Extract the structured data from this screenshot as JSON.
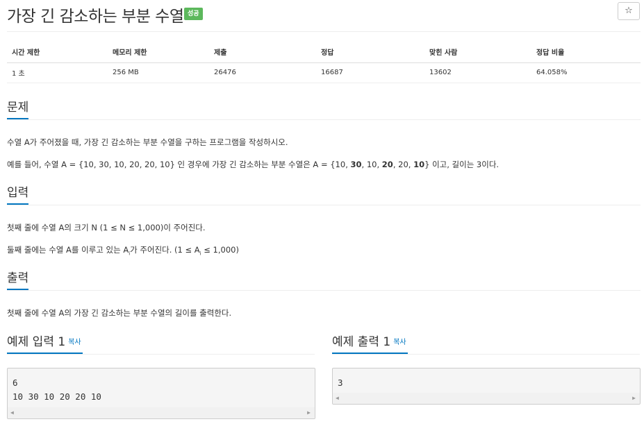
{
  "header": {
    "title": "가장 긴 감소하는 부분 수열",
    "badge": "성공",
    "star": "☆"
  },
  "info_table": {
    "headers": [
      "시간 제한",
      "메모리 제한",
      "제출",
      "정답",
      "맞힌 사람",
      "정답 비율"
    ],
    "row": [
      "1 초",
      "256 MB",
      "26476",
      "16687",
      "13602",
      "64.058%"
    ]
  },
  "problem": {
    "heading": "문제",
    "line1": "수열 A가 주어졌을 때, 가장 긴 감소하는 부분 수열을 구하는 프로그램을 작성하시오.",
    "line2_parts": [
      "예를 들어, 수열 A = {10, 30, 10, 20, 20, 10} 인 경우에 가장 긴 감소하는 부분 수열은 A = {10, ",
      "30",
      ", 10, ",
      "20",
      ", 20, ",
      "10",
      "}  이고, 길이는 3이다."
    ]
  },
  "input": {
    "heading": "입력",
    "line1": "첫째 줄에 수열 A의 크기 N (1 ≤ N ≤ 1,000)이 주어진다.",
    "line2_a": "둘째 줄에는 수열 A를 이루고 있는 A",
    "line2_sub": "i",
    "line2_b": "가 주어진다. (1 ≤ A",
    "line2_sub2": "i",
    "line2_c": " ≤ 1,000)"
  },
  "output": {
    "heading": "출력",
    "line1": "첫째 줄에 수열 A의 가장 긴 감소하는 부분 수열의 길이를 출력한다."
  },
  "sample_input": {
    "heading": "예제 입력 1",
    "copy": "복사",
    "content": "6\n10 30 10 20 20 10"
  },
  "sample_output": {
    "heading": "예제 출력 1",
    "copy": "복사",
    "content": "3"
  },
  "colors": {
    "accent": "#0076c0",
    "success": "#5cb85c"
  }
}
